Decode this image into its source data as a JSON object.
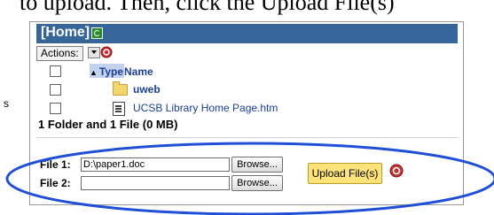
{
  "instruction_text": "to upload.  Then, click the Upload File(s)",
  "side_text": "s",
  "header": {
    "title": "[Home]"
  },
  "actions": {
    "label": "Actions:"
  },
  "columns": {
    "type": "Type",
    "name": "Name"
  },
  "rows": [
    {
      "name": "uweb",
      "kind": "folder"
    },
    {
      "name": "UCSB Library Home Page.htm",
      "kind": "file"
    }
  ],
  "summary": "1 Folder and 1 File (0 MB)",
  "upload": {
    "file1_label": "File 1:",
    "file1_value": "D:\\paper1.doc",
    "file2_label": "File 2:",
    "file2_value": "",
    "browse_label": "Browse...",
    "upload_label": "Upload File(s)"
  },
  "colors": {
    "header_bar": "#36659a",
    "highlight_oval": "#1f4fd6",
    "upload_button": "#fbe37a",
    "link_text": "#1b3f93"
  }
}
